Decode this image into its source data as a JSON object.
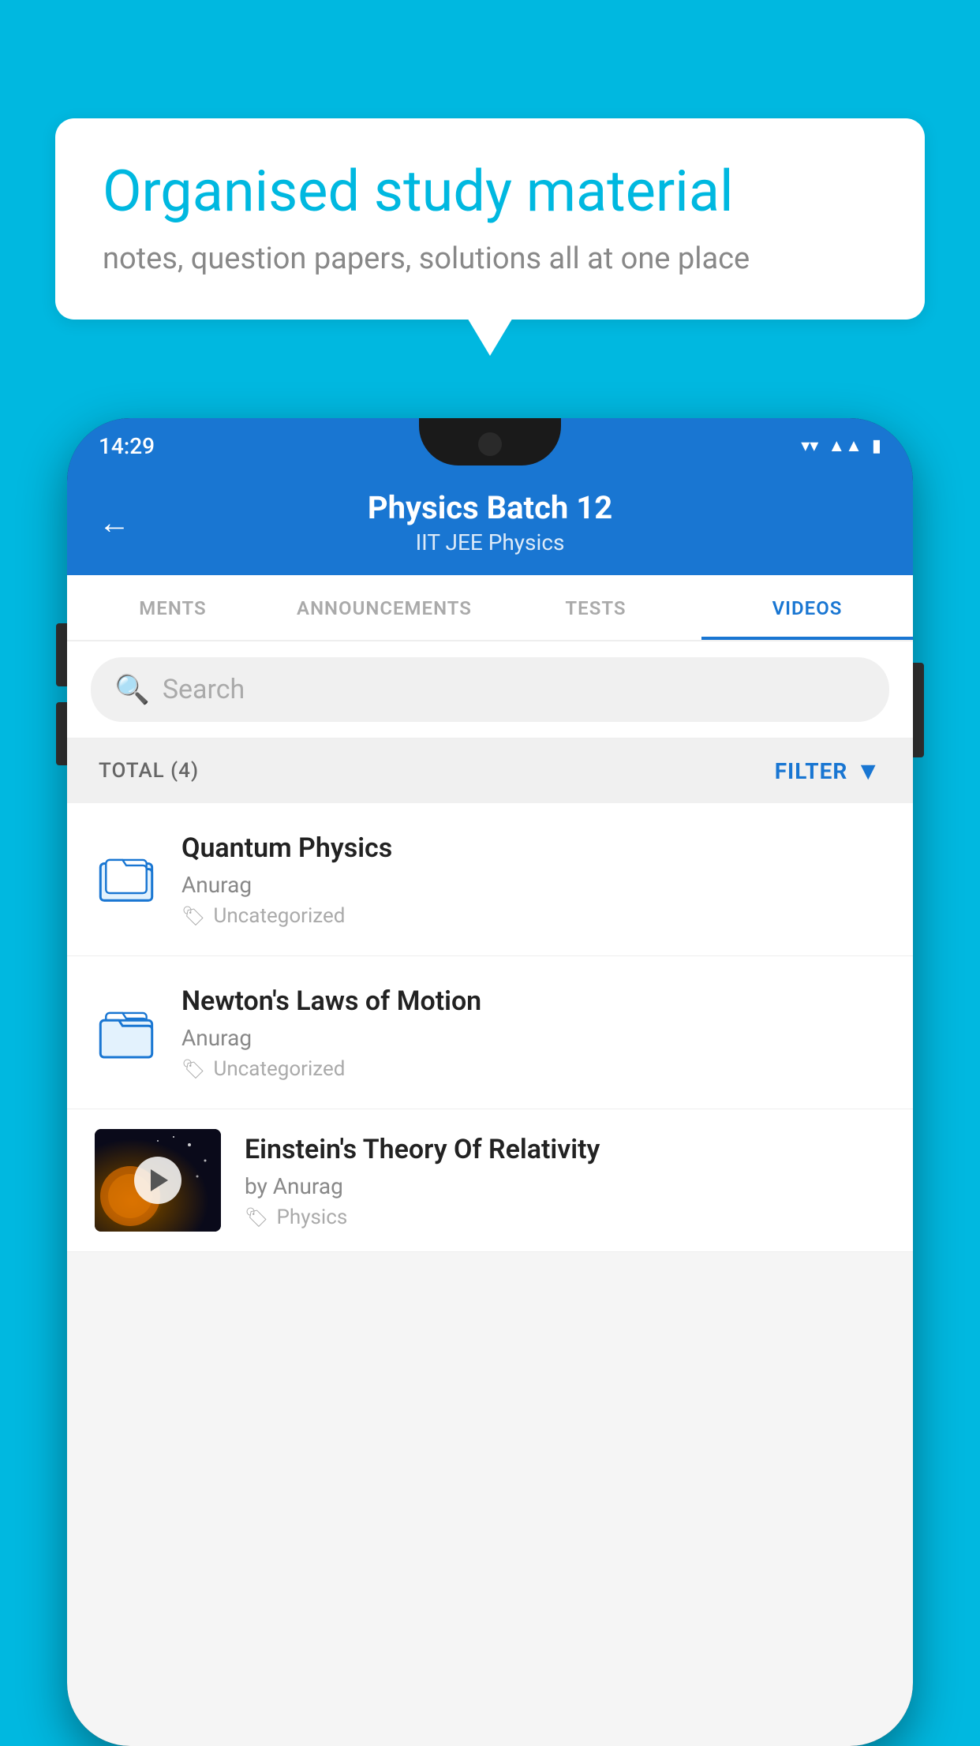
{
  "background_color": "#00b8e0",
  "bubble": {
    "title": "Organised study material",
    "subtitle": "notes, question papers, solutions all at one place"
  },
  "status_bar": {
    "time": "14:29",
    "wifi": "▼",
    "signal": "▲",
    "battery": "▮"
  },
  "app_bar": {
    "back_label": "←",
    "title": "Physics Batch 12",
    "subtitle": "IIT JEE   Physics"
  },
  "tabs": [
    {
      "label": "MENTS",
      "active": false
    },
    {
      "label": "ANNOUNCEMENTS",
      "active": false
    },
    {
      "label": "TESTS",
      "active": false
    },
    {
      "label": "VIDEOS",
      "active": true
    }
  ],
  "search": {
    "placeholder": "Search"
  },
  "filter_bar": {
    "total": "TOTAL (4)",
    "filter_label": "FILTER"
  },
  "videos": [
    {
      "id": 1,
      "title": "Quantum Physics",
      "author": "Anurag",
      "tag": "Uncategorized",
      "has_thumbnail": false
    },
    {
      "id": 2,
      "title": "Newton's Laws of Motion",
      "author": "Anurag",
      "tag": "Uncategorized",
      "has_thumbnail": false
    },
    {
      "id": 3,
      "title": "Einstein's Theory Of Relativity",
      "author": "by Anurag",
      "tag": "Physics",
      "has_thumbnail": true
    }
  ]
}
